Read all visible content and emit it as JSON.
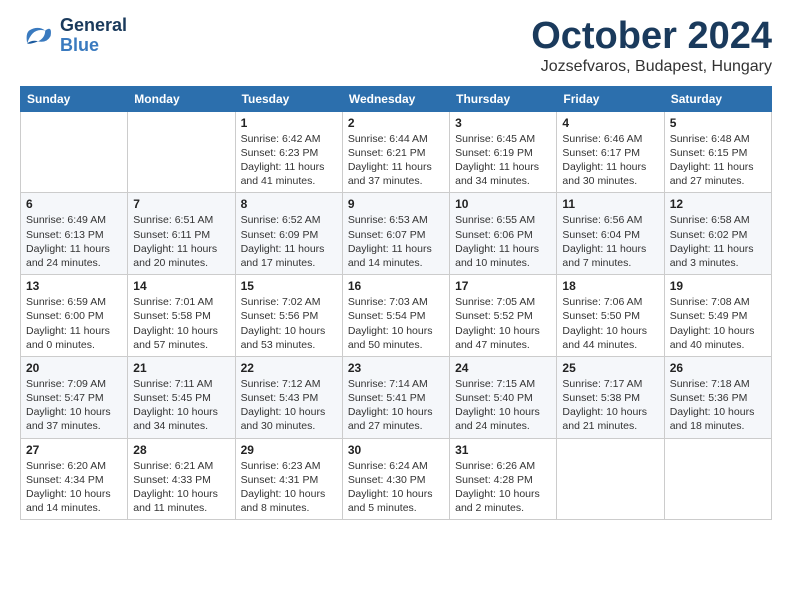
{
  "header": {
    "logo_general": "General",
    "logo_blue": "Blue",
    "month_title": "October 2024",
    "location": "Jozsefvaros, Budapest, Hungary"
  },
  "days_of_week": [
    "Sunday",
    "Monday",
    "Tuesday",
    "Wednesday",
    "Thursday",
    "Friday",
    "Saturday"
  ],
  "weeks": [
    [
      {
        "day": "",
        "sunrise": "",
        "sunset": "",
        "daylight": ""
      },
      {
        "day": "",
        "sunrise": "",
        "sunset": "",
        "daylight": ""
      },
      {
        "day": "1",
        "sunrise": "Sunrise: 6:42 AM",
        "sunset": "Sunset: 6:23 PM",
        "daylight": "Daylight: 11 hours and 41 minutes."
      },
      {
        "day": "2",
        "sunrise": "Sunrise: 6:44 AM",
        "sunset": "Sunset: 6:21 PM",
        "daylight": "Daylight: 11 hours and 37 minutes."
      },
      {
        "day": "3",
        "sunrise": "Sunrise: 6:45 AM",
        "sunset": "Sunset: 6:19 PM",
        "daylight": "Daylight: 11 hours and 34 minutes."
      },
      {
        "day": "4",
        "sunrise": "Sunrise: 6:46 AM",
        "sunset": "Sunset: 6:17 PM",
        "daylight": "Daylight: 11 hours and 30 minutes."
      },
      {
        "day": "5",
        "sunrise": "Sunrise: 6:48 AM",
        "sunset": "Sunset: 6:15 PM",
        "daylight": "Daylight: 11 hours and 27 minutes."
      }
    ],
    [
      {
        "day": "6",
        "sunrise": "Sunrise: 6:49 AM",
        "sunset": "Sunset: 6:13 PM",
        "daylight": "Daylight: 11 hours and 24 minutes."
      },
      {
        "day": "7",
        "sunrise": "Sunrise: 6:51 AM",
        "sunset": "Sunset: 6:11 PM",
        "daylight": "Daylight: 11 hours and 20 minutes."
      },
      {
        "day": "8",
        "sunrise": "Sunrise: 6:52 AM",
        "sunset": "Sunset: 6:09 PM",
        "daylight": "Daylight: 11 hours and 17 minutes."
      },
      {
        "day": "9",
        "sunrise": "Sunrise: 6:53 AM",
        "sunset": "Sunset: 6:07 PM",
        "daylight": "Daylight: 11 hours and 14 minutes."
      },
      {
        "day": "10",
        "sunrise": "Sunrise: 6:55 AM",
        "sunset": "Sunset: 6:06 PM",
        "daylight": "Daylight: 11 hours and 10 minutes."
      },
      {
        "day": "11",
        "sunrise": "Sunrise: 6:56 AM",
        "sunset": "Sunset: 6:04 PM",
        "daylight": "Daylight: 11 hours and 7 minutes."
      },
      {
        "day": "12",
        "sunrise": "Sunrise: 6:58 AM",
        "sunset": "Sunset: 6:02 PM",
        "daylight": "Daylight: 11 hours and 3 minutes."
      }
    ],
    [
      {
        "day": "13",
        "sunrise": "Sunrise: 6:59 AM",
        "sunset": "Sunset: 6:00 PM",
        "daylight": "Daylight: 11 hours and 0 minutes."
      },
      {
        "day": "14",
        "sunrise": "Sunrise: 7:01 AM",
        "sunset": "Sunset: 5:58 PM",
        "daylight": "Daylight: 10 hours and 57 minutes."
      },
      {
        "day": "15",
        "sunrise": "Sunrise: 7:02 AM",
        "sunset": "Sunset: 5:56 PM",
        "daylight": "Daylight: 10 hours and 53 minutes."
      },
      {
        "day": "16",
        "sunrise": "Sunrise: 7:03 AM",
        "sunset": "Sunset: 5:54 PM",
        "daylight": "Daylight: 10 hours and 50 minutes."
      },
      {
        "day": "17",
        "sunrise": "Sunrise: 7:05 AM",
        "sunset": "Sunset: 5:52 PM",
        "daylight": "Daylight: 10 hours and 47 minutes."
      },
      {
        "day": "18",
        "sunrise": "Sunrise: 7:06 AM",
        "sunset": "Sunset: 5:50 PM",
        "daylight": "Daylight: 10 hours and 44 minutes."
      },
      {
        "day": "19",
        "sunrise": "Sunrise: 7:08 AM",
        "sunset": "Sunset: 5:49 PM",
        "daylight": "Daylight: 10 hours and 40 minutes."
      }
    ],
    [
      {
        "day": "20",
        "sunrise": "Sunrise: 7:09 AM",
        "sunset": "Sunset: 5:47 PM",
        "daylight": "Daylight: 10 hours and 37 minutes."
      },
      {
        "day": "21",
        "sunrise": "Sunrise: 7:11 AM",
        "sunset": "Sunset: 5:45 PM",
        "daylight": "Daylight: 10 hours and 34 minutes."
      },
      {
        "day": "22",
        "sunrise": "Sunrise: 7:12 AM",
        "sunset": "Sunset: 5:43 PM",
        "daylight": "Daylight: 10 hours and 30 minutes."
      },
      {
        "day": "23",
        "sunrise": "Sunrise: 7:14 AM",
        "sunset": "Sunset: 5:41 PM",
        "daylight": "Daylight: 10 hours and 27 minutes."
      },
      {
        "day": "24",
        "sunrise": "Sunrise: 7:15 AM",
        "sunset": "Sunset: 5:40 PM",
        "daylight": "Daylight: 10 hours and 24 minutes."
      },
      {
        "day": "25",
        "sunrise": "Sunrise: 7:17 AM",
        "sunset": "Sunset: 5:38 PM",
        "daylight": "Daylight: 10 hours and 21 minutes."
      },
      {
        "day": "26",
        "sunrise": "Sunrise: 7:18 AM",
        "sunset": "Sunset: 5:36 PM",
        "daylight": "Daylight: 10 hours and 18 minutes."
      }
    ],
    [
      {
        "day": "27",
        "sunrise": "Sunrise: 6:20 AM",
        "sunset": "Sunset: 4:34 PM",
        "daylight": "Daylight: 10 hours and 14 minutes."
      },
      {
        "day": "28",
        "sunrise": "Sunrise: 6:21 AM",
        "sunset": "Sunset: 4:33 PM",
        "daylight": "Daylight: 10 hours and 11 minutes."
      },
      {
        "day": "29",
        "sunrise": "Sunrise: 6:23 AM",
        "sunset": "Sunset: 4:31 PM",
        "daylight": "Daylight: 10 hours and 8 minutes."
      },
      {
        "day": "30",
        "sunrise": "Sunrise: 6:24 AM",
        "sunset": "Sunset: 4:30 PM",
        "daylight": "Daylight: 10 hours and 5 minutes."
      },
      {
        "day": "31",
        "sunrise": "Sunrise: 6:26 AM",
        "sunset": "Sunset: 4:28 PM",
        "daylight": "Daylight: 10 hours and 2 minutes."
      },
      {
        "day": "",
        "sunrise": "",
        "sunset": "",
        "daylight": ""
      },
      {
        "day": "",
        "sunrise": "",
        "sunset": "",
        "daylight": ""
      }
    ]
  ]
}
